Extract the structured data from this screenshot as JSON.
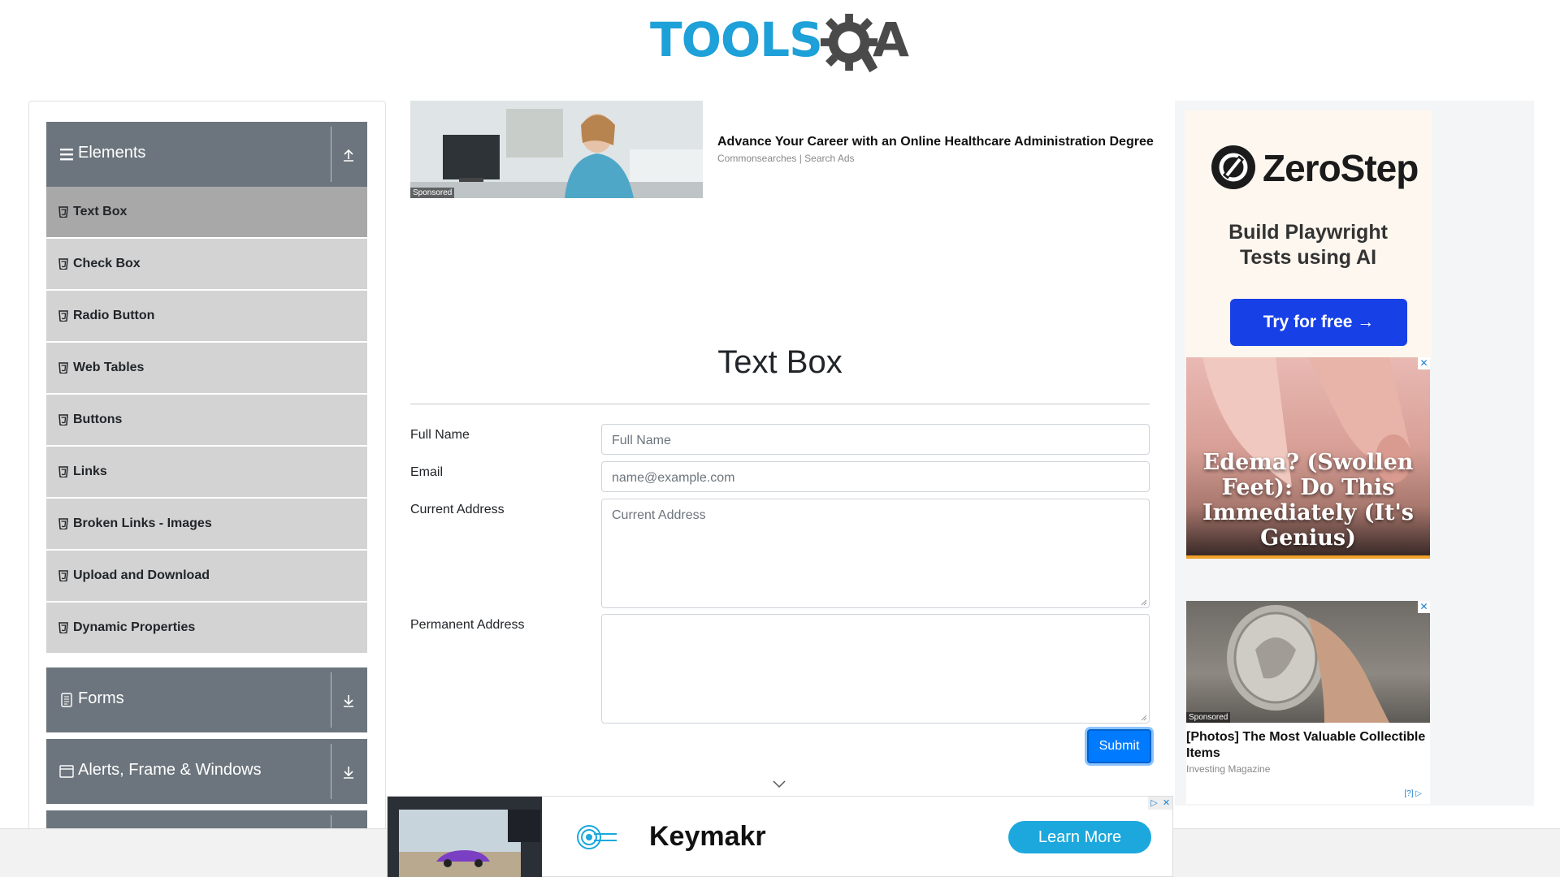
{
  "logo": {
    "text": "TOOLS",
    "suffix": "A",
    "colors": {
      "primary": "#1ea0d8",
      "secondary": "#4a4a4a"
    }
  },
  "sidebar": {
    "groups": [
      {
        "title": "Elements",
        "icon": "hamburger-icon",
        "arrow": "arrow-up-icon"
      },
      {
        "title": "Forms",
        "icon": "document-icon",
        "arrow": "arrow-down-icon"
      },
      {
        "title": "Alerts, Frame & Windows",
        "icon": "window-icon",
        "arrow": "arrow-down-icon"
      }
    ],
    "items": [
      {
        "label": "Text Box",
        "active": true
      },
      {
        "label": "Check Box"
      },
      {
        "label": "Radio Button"
      },
      {
        "label": "Web Tables"
      },
      {
        "label": "Buttons"
      },
      {
        "label": "Links"
      },
      {
        "label": "Broken Links - Images"
      },
      {
        "label": "Upload and Download"
      },
      {
        "label": "Dynamic Properties"
      }
    ]
  },
  "sponsored_top": {
    "tag": "Sponsored",
    "title": "Advance Your Career with an Online Healthcare Administration Degree",
    "source": "Commonsearches | Search Ads"
  },
  "main": {
    "title": "Text Box",
    "fields": [
      {
        "label": "Full Name",
        "placeholder": "Full Name"
      },
      {
        "label": "Email",
        "placeholder": "name@example.com"
      },
      {
        "label": "Current Address",
        "placeholder": "Current Address"
      },
      {
        "label": "Permanent Address",
        "placeholder": ""
      }
    ],
    "submit_label": "Submit",
    "accent": "#007bff"
  },
  "right_ads": {
    "zerostep": {
      "brand": "ZeroStep",
      "line1": "Build Playwright",
      "line2": "Tests using AI",
      "button": "Try for free →"
    },
    "edema": {
      "text": "Edema? (Swollen Feet): Do This Immediately (It's Genius)",
      "close": "✕"
    },
    "coin": {
      "tag": "Sponsored",
      "title": "[Photos] The Most Valuable Collectible Items",
      "source": "Investing Magazine",
      "adchoices": "[?]",
      "close": "✕"
    }
  },
  "bottom_ad": {
    "brand": "Keymakr",
    "button": "Learn More"
  }
}
